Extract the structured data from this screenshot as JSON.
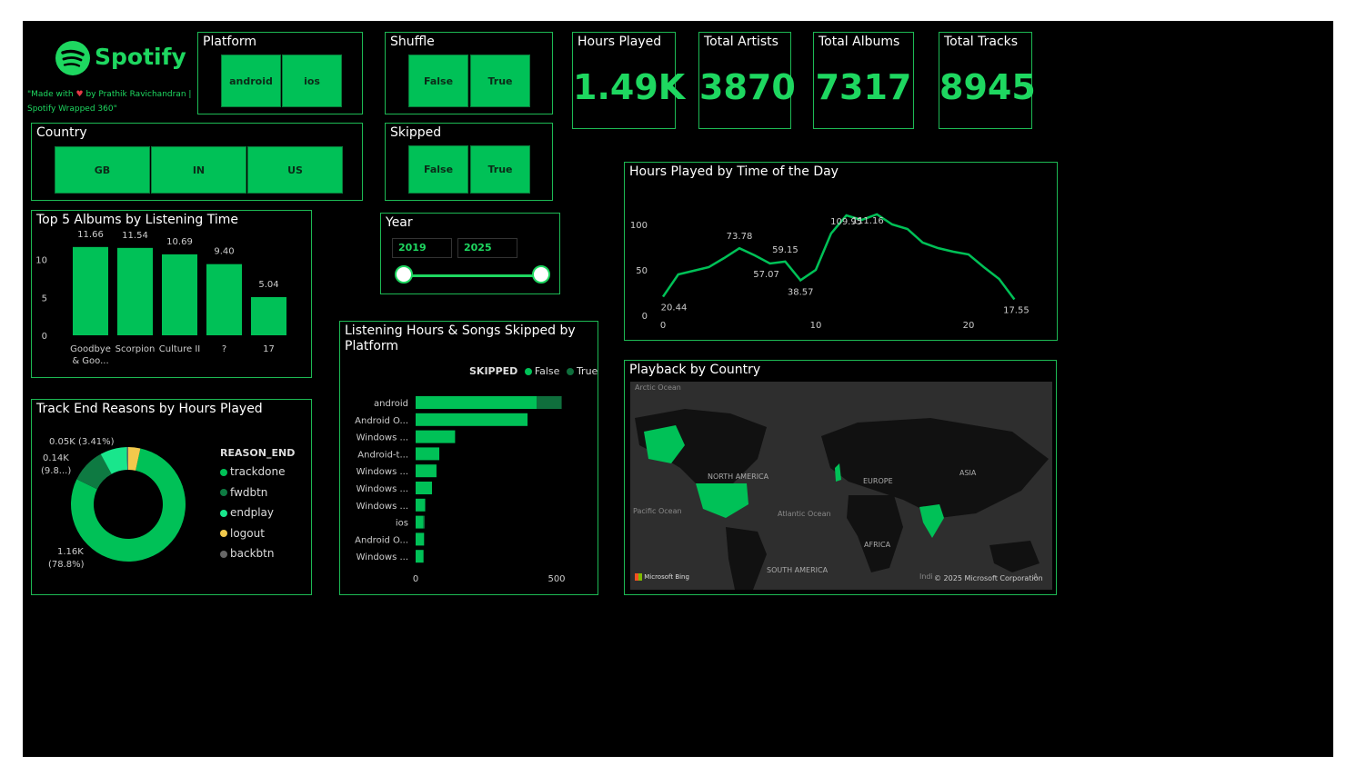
{
  "colors": {
    "accent": "#1ed760",
    "bar": "#00c157",
    "dark_green": "#0f6e3c",
    "background": "#000000"
  },
  "logo": {
    "text": "Spotify",
    "credit_line1": "\"Made with ",
    "credit_line1b": " by Prathik Ravichandran |",
    "credit_line2": "Spotify Wrapped 360\""
  },
  "slicers": {
    "platform": {
      "title": "Platform",
      "options": [
        "android",
        "ios"
      ]
    },
    "shuffle": {
      "title": "Shuffle",
      "options": [
        "False",
        "True"
      ]
    },
    "country": {
      "title": "Country",
      "options": [
        "GB",
        "IN",
        "US"
      ]
    },
    "skipped": {
      "title": "Skipped",
      "options": [
        "False",
        "True"
      ]
    },
    "year": {
      "title": "Year",
      "start": "2019",
      "end": "2025"
    }
  },
  "kpis": [
    {
      "title": "Hours Played",
      "value": "1.49K"
    },
    {
      "title": "Total Artists",
      "value": "3870"
    },
    {
      "title": "Total Albums",
      "value": "7317"
    },
    {
      "title": "Total Tracks",
      "value": "8945"
    }
  ],
  "map": {
    "title": "Playback by Country",
    "labels": {
      "arctic": "Arctic Ocean",
      "na": "NORTH AMERICA",
      "europe": "EUROPE",
      "asia": "ASIA",
      "pacific": "Pacific Ocean",
      "atlantic": "Atlantic Ocean",
      "africa": "AFRICA",
      "sa": "SOUTH AMERICA",
      "indian": "Indi",
      "indian2": "A",
      "copyright": "© 2025 Microsoft Corporation",
      "bing": "Microsoft Bing"
    }
  },
  "chart_data": [
    {
      "type": "bar",
      "title": "Top 5 Albums by Listening Time",
      "categories": [
        "Goodbye & Goo...",
        "Scorpion",
        "Culture II",
        "?",
        "17"
      ],
      "values": [
        11.66,
        11.54,
        10.69,
        9.4,
        5.04
      ],
      "data_labels": [
        "11.66",
        "11.54",
        "10.69",
        "9.40",
        "5.04"
      ],
      "yticks": [
        "0",
        "5",
        "10"
      ],
      "ylim": [
        0,
        12
      ]
    },
    {
      "type": "pie",
      "title": "Track End Reasons by Hours Played",
      "legend_title": "REASON_END",
      "categories": [
        "trackdone",
        "fwdbtn",
        "endplay",
        "logout",
        "backbtn"
      ],
      "values": [
        78.8,
        9.8,
        7.6,
        3.41,
        0.39
      ],
      "colors": [
        "#00c157",
        "#0e7a42",
        "#19e68c",
        "#f2c94c",
        "#666666"
      ],
      "data_labels": {
        "trackdone": [
          "1.16K",
          "(78.8%)"
        ],
        "fwdbtn": [
          "0.14K",
          "(9.8...)"
        ],
        "logout": [
          "0.05K (3.41%)"
        ]
      }
    },
    {
      "type": "bar",
      "orientation": "horizontal",
      "title": "Listening Hours & Songs Skipped by Platform",
      "legend_title": "SKIPPED",
      "categories": [
        "android",
        "Android O...",
        "Windows ...",
        "Android-t...",
        "Windows ...",
        "Windows ...",
        "Windows ...",
        "ios",
        "Android O...",
        "Windows ..."
      ],
      "series": [
        {
          "name": "False",
          "values": [
            430,
            397,
            140,
            84,
            74,
            58,
            34,
            28,
            30,
            28
          ]
        },
        {
          "name": "True",
          "values": [
            88,
            0,
            0,
            0,
            0,
            0,
            0,
            4,
            0,
            0
          ]
        }
      ],
      "xticks": [
        "0",
        "500"
      ],
      "xlim": [
        0,
        520
      ]
    },
    {
      "type": "line",
      "title": "Hours Played by Time of the Day",
      "x": [
        0,
        1,
        2,
        3,
        4,
        5,
        6,
        7,
        8,
        9,
        10,
        11,
        12,
        13,
        14,
        15,
        16,
        17,
        18,
        19,
        20,
        21,
        22,
        23
      ],
      "values": [
        20.44,
        45,
        49,
        53,
        63,
        73.78,
        66,
        57.07,
        59.15,
        38.57,
        50,
        90,
        109.95,
        105,
        111.16,
        100,
        95,
        80,
        74,
        70,
        67,
        53,
        40,
        17.55
      ],
      "data_labels": {
        "0": "20.44",
        "5": "73.78",
        "7": "57.07",
        "8": "59.15",
        "9": "38.57",
        "12": "109.95",
        "14": "111.16",
        "23": "17.55"
      },
      "xticks": [
        "0",
        "10",
        "20"
      ],
      "yticks": [
        "0",
        "50",
        "100"
      ],
      "ylim": [
        0,
        115
      ]
    }
  ]
}
